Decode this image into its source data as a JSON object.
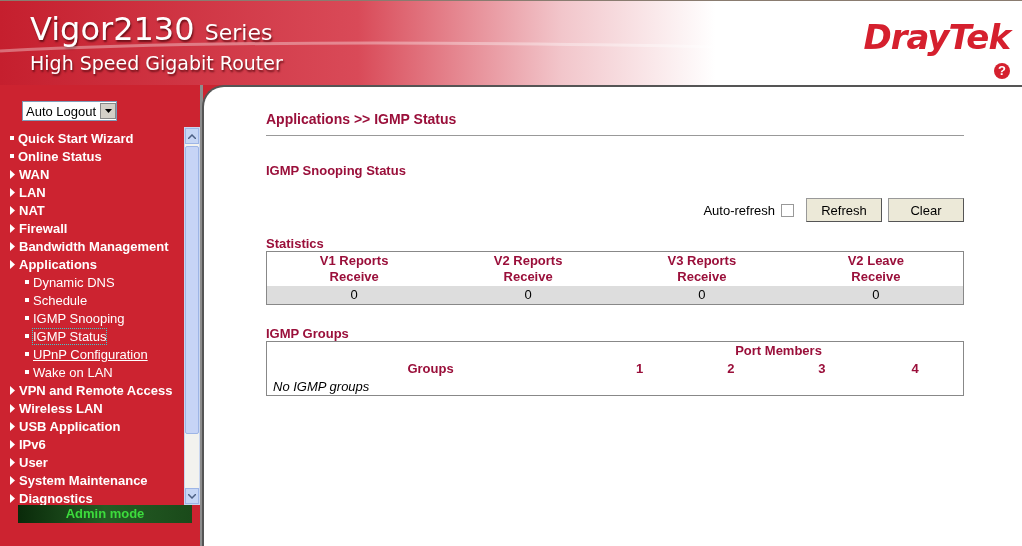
{
  "header": {
    "product": "Vigor2130",
    "series": "Series",
    "subtitle": "High Speed Gigabit Router",
    "brand": "DrayTek",
    "help": "?"
  },
  "sidebar": {
    "logout_select": "Auto Logout",
    "menu": [
      {
        "label": "Quick Start Wizard",
        "kind": "leaf",
        "selected": false,
        "hovered": false
      },
      {
        "label": "Online Status",
        "kind": "leaf",
        "selected": false,
        "hovered": false
      },
      {
        "label": "WAN",
        "kind": "folder",
        "selected": false,
        "hovered": false
      },
      {
        "label": "LAN",
        "kind": "folder",
        "selected": false,
        "hovered": false
      },
      {
        "label": "NAT",
        "kind": "folder",
        "selected": false,
        "hovered": false
      },
      {
        "label": "Firewall",
        "kind": "folder",
        "selected": false,
        "hovered": false
      },
      {
        "label": "Bandwidth Management",
        "kind": "folder",
        "selected": false,
        "hovered": false
      },
      {
        "label": "Applications",
        "kind": "folder",
        "selected": false,
        "hovered": false,
        "children": [
          {
            "label": "Dynamic DNS",
            "kind": "leaf",
            "selected": false,
            "hovered": false
          },
          {
            "label": "Schedule",
            "kind": "leaf",
            "selected": false,
            "hovered": false
          },
          {
            "label": "IGMP Snooping",
            "kind": "leaf",
            "selected": false,
            "hovered": false
          },
          {
            "label": "IGMP Status",
            "kind": "leaf",
            "selected": true,
            "hovered": false
          },
          {
            "label": "UPnP Configuration",
            "kind": "leaf",
            "selected": false,
            "hovered": true
          },
          {
            "label": "Wake on LAN",
            "kind": "leaf",
            "selected": false,
            "hovered": false
          }
        ]
      },
      {
        "label": "VPN and Remote Access",
        "kind": "folder",
        "selected": false,
        "hovered": false
      },
      {
        "label": "Wireless LAN",
        "kind": "folder",
        "selected": false,
        "hovered": false
      },
      {
        "label": "USB Application",
        "kind": "folder",
        "selected": false,
        "hovered": false
      },
      {
        "label": "IPv6",
        "kind": "folder",
        "selected": false,
        "hovered": false
      },
      {
        "label": "User",
        "kind": "folder",
        "selected": false,
        "hovered": false
      },
      {
        "label": "System Maintenance",
        "kind": "folder",
        "selected": false,
        "hovered": false
      },
      {
        "label": "Diagnostics",
        "kind": "folder",
        "selected": false,
        "hovered": false
      }
    ],
    "mode": "Admin mode"
  },
  "content": {
    "breadcrumb": "Applications >> IGMP Status",
    "section_title": "IGMP Snooping Status",
    "auto_refresh": {
      "label": "Auto-refresh",
      "checked": false
    },
    "buttons": [
      "Refresh",
      "Clear"
    ],
    "statistics": {
      "title": "Statistics",
      "columns": [
        "V1 Reports Receive",
        "V2 Reports Receive",
        "V3 Reports Receive",
        "V2 Leave Receive"
      ],
      "values": [
        "0",
        "0",
        "0",
        "0"
      ]
    },
    "groups": {
      "title": "IGMP Groups",
      "groups_column": "Groups",
      "port_members": "Port Members",
      "ports": [
        "1",
        "2",
        "3",
        "4"
      ],
      "empty": "No IGMP groups"
    }
  }
}
